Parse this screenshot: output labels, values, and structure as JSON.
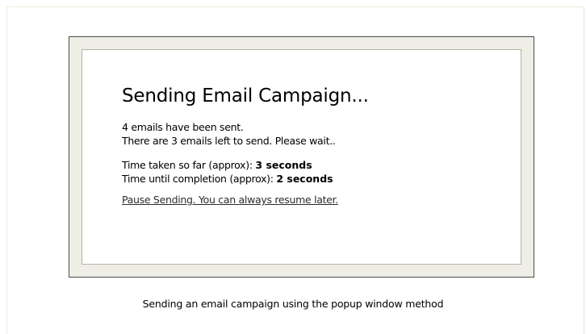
{
  "popup": {
    "title": "Sending Email Campaign...",
    "sent_line": "4 emails have been sent.",
    "remaining_line": "There are 3 emails left to send. Please wait..",
    "time_taken_label": "Time taken so far (approx): ",
    "time_taken_value": "3 seconds",
    "time_remaining_label": "Time until completion (approx): ",
    "time_remaining_value": "2 seconds",
    "pause_link": "Pause Sending. You can always resume later."
  },
  "caption": "Sending an email campaign using the popup window method"
}
